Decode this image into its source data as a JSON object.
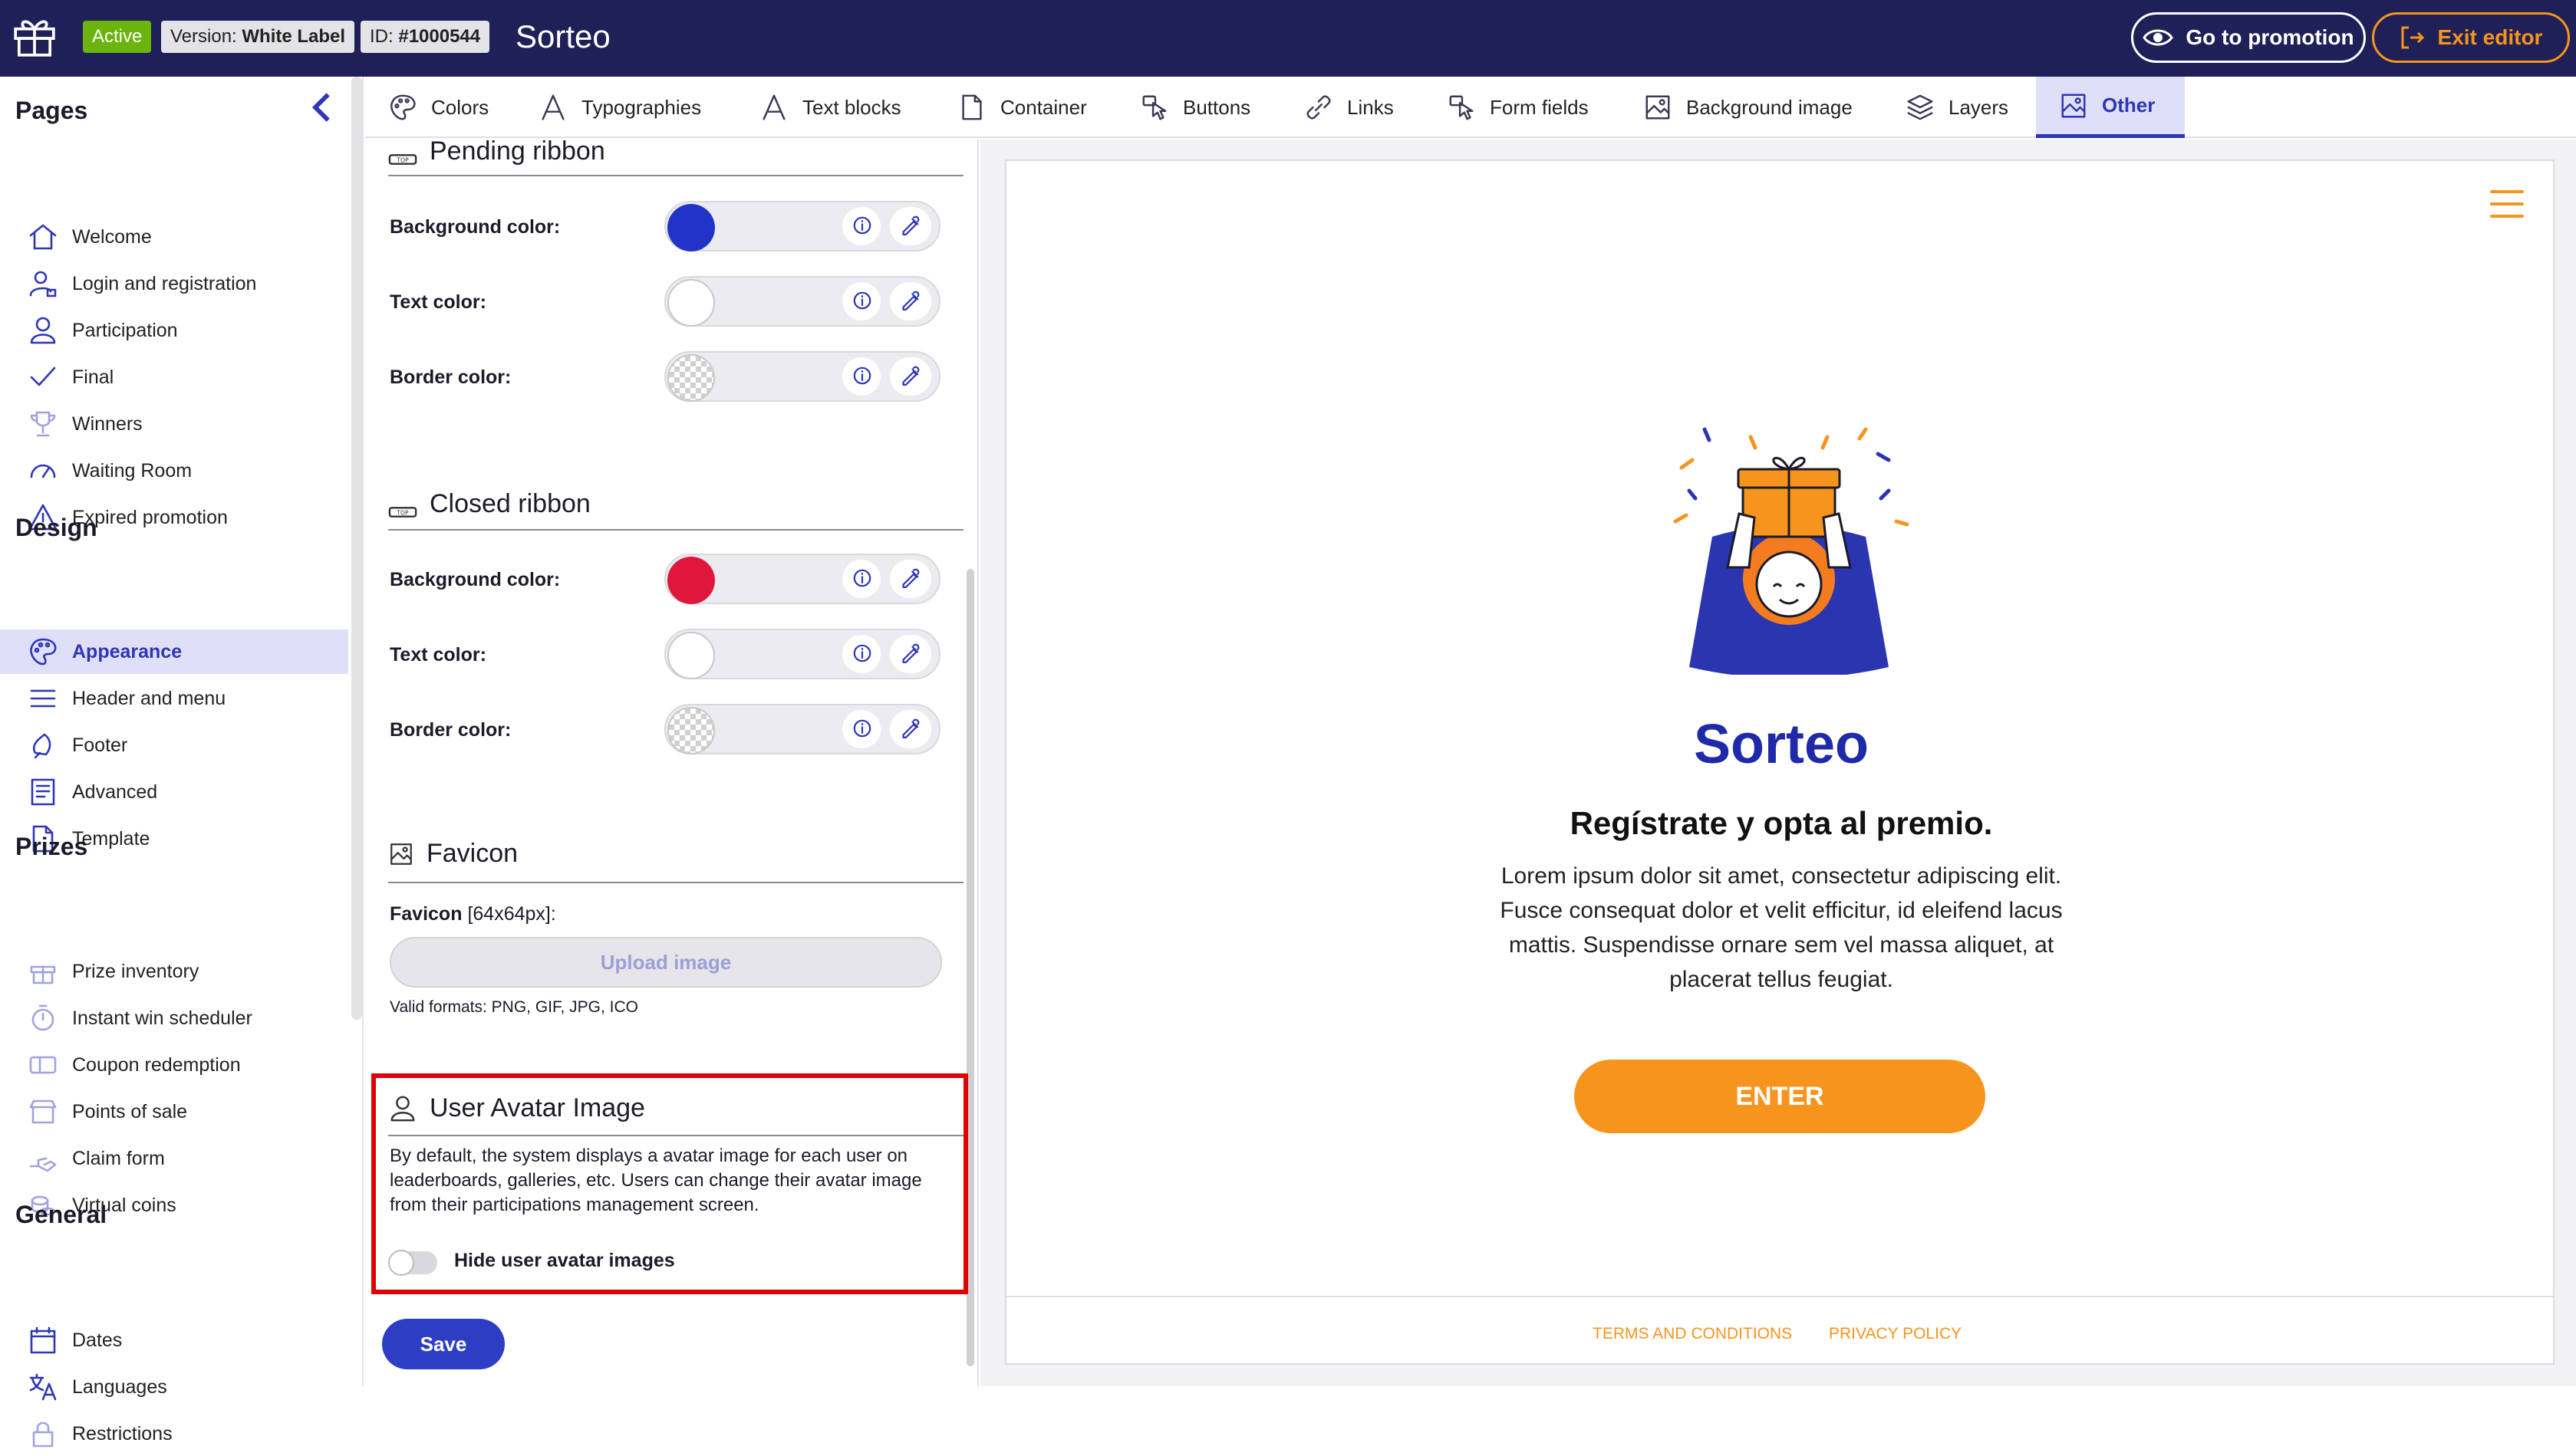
{
  "topbar": {
    "status": "Active",
    "version_prefix": "Version:",
    "version_value": "White Label",
    "id_prefix": "ID:",
    "id_value": "#1000544",
    "title": "Sorteo",
    "go_promotion": "Go to promotion",
    "exit_editor": "Exit editor"
  },
  "sidebar": {
    "pages_heading": "Pages",
    "pages": [
      {
        "label": "Welcome",
        "icon": "home-icon"
      },
      {
        "label": "Login and registration",
        "icon": "user-lock-icon"
      },
      {
        "label": "Participation",
        "icon": "user-icon"
      },
      {
        "label": "Final",
        "icon": "check-icon"
      },
      {
        "label": "Winners",
        "icon": "trophy-icon"
      },
      {
        "label": "Waiting Room",
        "icon": "gauge-icon"
      },
      {
        "label": "Expired promotion",
        "icon": "warning-icon"
      }
    ],
    "design_heading": "Design",
    "design": [
      {
        "label": "Appearance",
        "icon": "palette-icon"
      },
      {
        "label": "Header and menu",
        "icon": "menu-icon"
      },
      {
        "label": "Footer",
        "icon": "footer-icon"
      },
      {
        "label": "Advanced",
        "icon": "code-icon"
      },
      {
        "label": "Template",
        "icon": "file-icon"
      }
    ],
    "prizes_heading": "Prizes",
    "prizes": [
      {
        "label": "Prize inventory",
        "icon": "gift-icon"
      },
      {
        "label": "Instant win scheduler",
        "icon": "stopwatch-icon"
      },
      {
        "label": "Coupon redemption",
        "icon": "coupon-icon"
      },
      {
        "label": "Points of sale",
        "icon": "store-icon"
      },
      {
        "label": "Claim form",
        "icon": "hand-icon"
      },
      {
        "label": "Virtual coins",
        "icon": "coins-icon"
      }
    ],
    "general_heading": "General",
    "general": [
      {
        "label": "Dates",
        "icon": "calendar-icon"
      },
      {
        "label": "Languages",
        "icon": "translate-icon"
      },
      {
        "label": "Restrictions",
        "icon": "lock-icon"
      }
    ]
  },
  "tabs": [
    {
      "label": "Colors",
      "icon": "palette-icon"
    },
    {
      "label": "Typographies",
      "icon": "font-icon"
    },
    {
      "label": "Text blocks",
      "icon": "font-icon"
    },
    {
      "label": "Container",
      "icon": "file-icon"
    },
    {
      "label": "Buttons",
      "icon": "pointer-icon"
    },
    {
      "label": "Links",
      "icon": "link-icon"
    },
    {
      "label": "Form fields",
      "icon": "pointer-icon"
    },
    {
      "label": "Background image",
      "icon": "image-icon"
    },
    {
      "label": "Layers",
      "icon": "layers-icon"
    },
    {
      "label": "Other",
      "icon": "image-icon"
    }
  ],
  "panel": {
    "pending_title": "Pending ribbon",
    "closed_title": "Closed ribbon",
    "background_label": "Background color:",
    "text_label": "Text color:",
    "border_label": "Border color:",
    "pending_colors": {
      "background": "#2233c8",
      "text": "#ffffff",
      "border": "transparent"
    },
    "closed_colors": {
      "background": "#e0173c",
      "text": "#ffffff",
      "border": "transparent"
    },
    "favicon_title": "Favicon",
    "favicon_label": "Favicon",
    "favicon_size": "[64x64px]:",
    "upload_label": "Upload image",
    "valid_formats": "Valid formats: PNG, GIF, JPG, ICO",
    "avatar_title": "User Avatar Image",
    "avatar_desc": "By default, the system displays a avatar image for each user on leaderboards, galleries, etc. Users can change their avatar image from their participations management screen.",
    "hide_avatar_label": "Hide user avatar images",
    "hide_avatar_on": false,
    "save_label": "Save"
  },
  "preview": {
    "title": "Sorteo",
    "subtitle": "Regístrate y opta al premio.",
    "body": "Lorem ipsum dolor sit amet, consectetur adipiscing elit. Fusce consequat dolor et velit efficitur, id eleifend lacus mattis. Suspendisse ornare sem vel massa aliquet, at placerat tellus feugiat.",
    "enter_label": "ENTER",
    "terms": "TERMS AND CONDITIONS",
    "privacy": "PRIVACY POLICY"
  },
  "colors": {
    "navy": "#1f2057",
    "accent": "#2e36b6",
    "orange": "#f7941d",
    "active_green": "#6bb40d",
    "highlight": "#e00000"
  }
}
